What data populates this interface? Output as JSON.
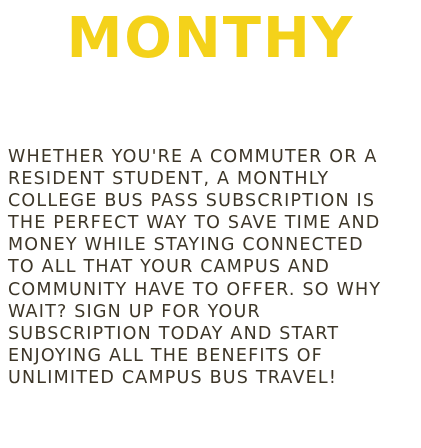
{
  "heading": {
    "title": "MONTHY",
    "color": "#f4d21a"
  },
  "body": {
    "text_color": "#3d3628",
    "lines": [
      "WHETHER YOU'RE A COMMUTER OR A",
      "RESIDENT STUDENT, A MONTHLY",
      "COLLEGE BUS PASS SUBSCRIPTION IS",
      "THE PERFECT WAY TO SAVE TIME AND",
      "MONEY WHILE STAYING CONNECTED",
      "TO ALL THAT YOUR CAMPUS AND",
      "COMMUNITY HAVE TO OFFER. SO WHY",
      "WAIT? SIGN UP FOR YOUR",
      "SUBSCRIPTION TODAY AND START",
      "ENJOYING ALL THE BENEFITS OF",
      "UNLIMITED CAMPUS BUS TRAVEL!"
    ]
  }
}
